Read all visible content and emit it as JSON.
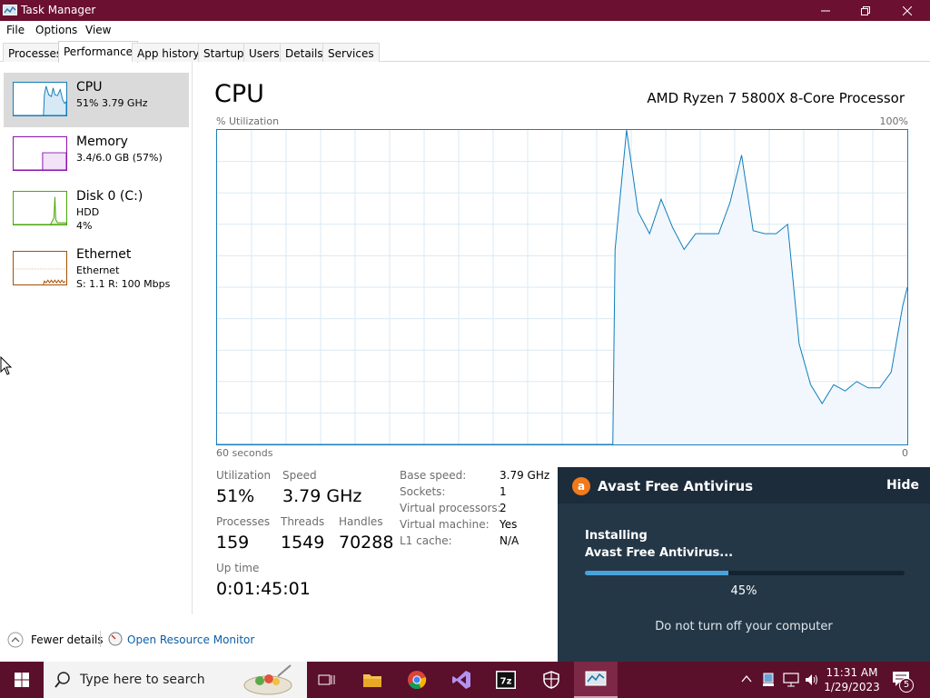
{
  "window": {
    "title": "Task Manager",
    "minimize_icon": "minimize-icon",
    "maximize_icon": "restore-icon",
    "close_icon": "close-icon"
  },
  "menu": [
    "File",
    "Options",
    "View"
  ],
  "tabs": [
    {
      "label": "Processes"
    },
    {
      "label": "Performance",
      "active": true
    },
    {
      "label": "App history"
    },
    {
      "label": "Startup"
    },
    {
      "label": "Users"
    },
    {
      "label": "Details"
    },
    {
      "label": "Services"
    }
  ],
  "sidebar": {
    "items": [
      {
        "name": "CPU",
        "line1": "51%  3.79 GHz",
        "line2": "",
        "color": "#117dbb",
        "selected": true
      },
      {
        "name": "Memory",
        "line1": "3.4/6.0 GB (57%)",
        "line2": "",
        "color": "#8b12ae",
        "selected": false
      },
      {
        "name": "Disk 0 (C:)",
        "line1": "HDD",
        "line2": "4%",
        "color": "#4da60c",
        "selected": false
      },
      {
        "name": "Ethernet",
        "line1": "Ethernet",
        "line2": "S: 1.1  R: 100 Mbps",
        "color": "#a74f01",
        "selected": false
      }
    ]
  },
  "main": {
    "title": "CPU",
    "processor": "AMD Ryzen 7 5800X 8-Core Processor",
    "graph_label": "% Utilization",
    "graph_max": "100%",
    "graph_time": "60 seconds",
    "graph_min": "0",
    "graph_color": "#117dbb"
  },
  "chart_data": {
    "type": "area",
    "title": "",
    "xlabel": "60 seconds",
    "ylabel": "% Utilization",
    "ylim": [
      0,
      100
    ],
    "xlim": [
      60,
      0
    ],
    "x": [
      60,
      25.6,
      25.4,
      24.4,
      23.4,
      22.4,
      21.4,
      20.4,
      19.4,
      18.4,
      17.4,
      16.4,
      15.4,
      14.4,
      13.4,
      12.4,
      11.4,
      10.4,
      9.4,
      8.4,
      7.4,
      6.4,
      5.4,
      4.4,
      3.4,
      2.4,
      1.4,
      0.4,
      0
    ],
    "y": [
      0,
      0,
      62,
      100,
      74,
      67,
      78,
      69,
      62,
      67,
      67,
      67,
      77,
      92,
      68,
      67,
      67,
      70,
      32,
      19,
      13,
      19,
      17,
      20,
      18,
      18,
      23,
      44,
      50
    ]
  },
  "stats": {
    "utilization_label": "Utilization",
    "utilization": "51%",
    "speed_label": "Speed",
    "speed": "3.79 GHz",
    "processes_label": "Processes",
    "processes": "159",
    "threads_label": "Threads",
    "threads": "1549",
    "handles_label": "Handles",
    "handles": "70288",
    "uptime_label": "Up time",
    "uptime": "0:01:45:01"
  },
  "props": [
    {
      "label": "Base speed:",
      "value": "3.79 GHz"
    },
    {
      "label": "Sockets:",
      "value": "1"
    },
    {
      "label": "Virtual processors:",
      "value": "2"
    },
    {
      "label": "Virtual machine:",
      "value": "Yes"
    },
    {
      "label": "L1 cache:",
      "value": "N/A"
    }
  ],
  "footer": {
    "fewer_details": "Fewer details",
    "open_resource_monitor": "Open Resource Monitor"
  },
  "avast": {
    "brand": "Avast Free Antivirus",
    "hide": "Hide",
    "installing": "Installing",
    "product": "Avast Free Antivirus...",
    "progress": 0.45,
    "percent": "45%",
    "warning": "Do not turn off your computer",
    "accent": "#f27a1b"
  },
  "taskbar": {
    "search_placeholder": "Type here to search",
    "time": "11:31 AM",
    "date": "1/29/2023",
    "notifications": "5",
    "icons": [
      "task-view-icon",
      "file-explorer-icon",
      "chrome-icon",
      "visual-studio-icon",
      "7zip-icon",
      "security-icon",
      "task-manager-icon"
    ]
  }
}
